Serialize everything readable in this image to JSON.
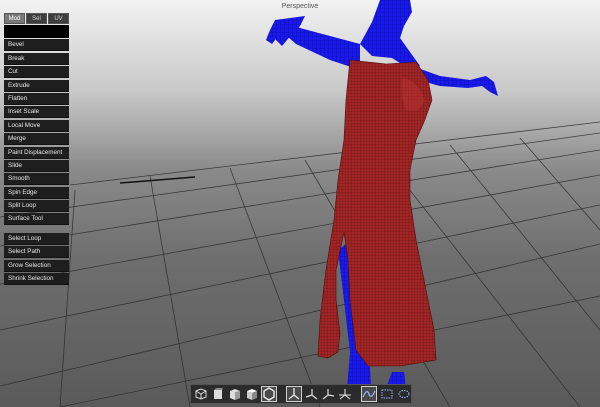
{
  "viewport": {
    "title": "Perspective"
  },
  "mode_tabs": [
    {
      "label": "Mod",
      "active": true
    },
    {
      "label": "Sel",
      "active": false
    },
    {
      "label": "UV",
      "active": false
    }
  ],
  "tools": [
    "Bevel",
    "Break",
    "Cut",
    "Extrude",
    "Flatten",
    "Inset Scale",
    "Local Move",
    "Merge",
    "Paint Displacement",
    "Slide",
    "Smooth",
    "Spin Edge",
    "Split Loop",
    "Surface Tool"
  ],
  "selection_tools": [
    "Select Loop",
    "Select Path",
    "Grow Selection",
    "Shrink Selection"
  ],
  "bottom_toolbar": {
    "items": [
      "view-cube-icon",
      "cube-front-icon",
      "cube-side-icon",
      "cube-top-icon",
      "cube-persp-icon",
      "axis-y-icon",
      "axis-x-icon",
      "axis-z-icon",
      "axis-all-icon",
      "curve-icon",
      "frame-icon",
      "ellipse-icon"
    ],
    "active": [
      "cube-persp-icon",
      "axis-y-icon"
    ]
  },
  "colors": {
    "body_mesh": "#1515e0",
    "dress_mesh": "#9a2222",
    "panel_bg": "#1e1e1e"
  }
}
